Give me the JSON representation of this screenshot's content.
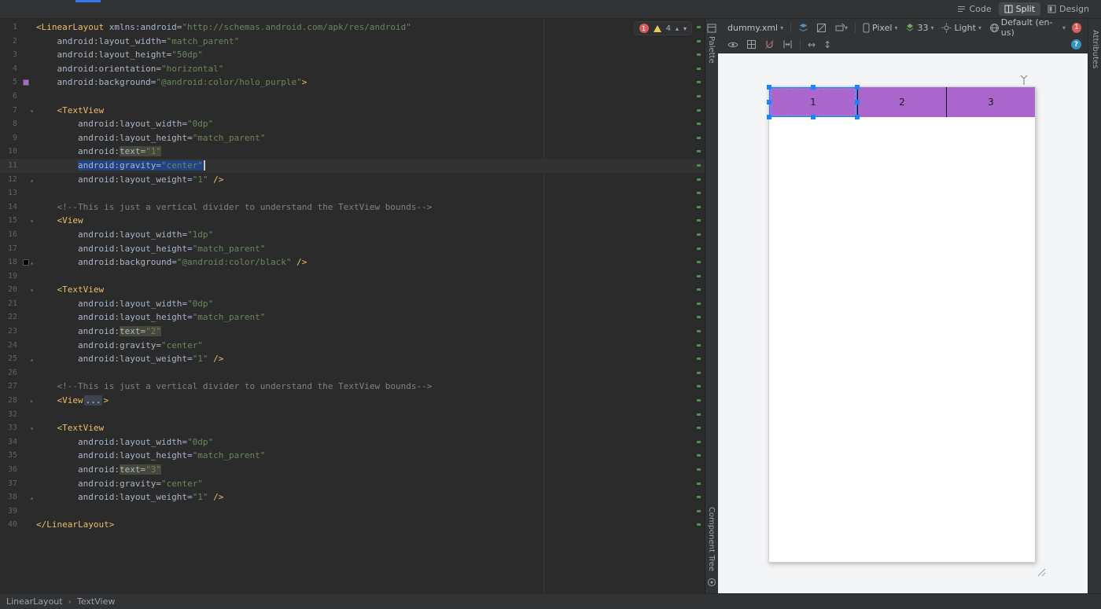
{
  "window": {
    "mode_tabs": [
      {
        "label": "Code"
      },
      {
        "label": "Split"
      },
      {
        "label": "Design"
      }
    ],
    "active_mode": "Split"
  },
  "icons": {
    "dropdown": "▾",
    "prev_issue": "▴",
    "next_issue": "▾",
    "fold_open": "▾",
    "fold_close": "▴",
    "fold_folded": "▸",
    "h_arrow": "↔",
    "v_arrow": "↕",
    "help": "?"
  },
  "editor": {
    "inspection": {
      "errors": "1",
      "warnings": "4"
    },
    "breadcrumbs": [
      "LinearLayout",
      "TextView"
    ],
    "breadcrumb_sep": "›",
    "lines": [
      {
        "n": "1",
        "tk": [
          [
            "t",
            "<LinearLayout"
          ],
          [
            "a",
            " xmlns:android"
          ],
          [
            "p",
            "="
          ],
          [
            "s",
            "\"http://schemas.android.com/apk/res/android\""
          ]
        ]
      },
      {
        "n": "2",
        "tk": [
          [
            "a",
            "    android:layout_width"
          ],
          [
            "p",
            "="
          ],
          [
            "s",
            "\"match_parent\""
          ]
        ]
      },
      {
        "n": "3",
        "tk": [
          [
            "a",
            "    android:layout_height"
          ],
          [
            "p",
            "="
          ],
          [
            "s",
            "\"50dp\""
          ]
        ]
      },
      {
        "n": "4",
        "tk": [
          [
            "a",
            "    android:orientation"
          ],
          [
            "p",
            "="
          ],
          [
            "s",
            "\"horizontal\""
          ]
        ]
      },
      {
        "n": "5",
        "sw": "#aa66cc",
        "tk": [
          [
            "a",
            "    android:background"
          ],
          [
            "p",
            "="
          ],
          [
            "s",
            "\"@android:color/holo_purple\""
          ],
          [
            "t",
            ">"
          ]
        ]
      },
      {
        "n": "6",
        "tk": []
      },
      {
        "n": "7",
        "fold": "open",
        "tk": [
          [
            "t",
            "    <TextView"
          ]
        ]
      },
      {
        "n": "8",
        "tk": [
          [
            "a",
            "        android:layout_width"
          ],
          [
            "p",
            "="
          ],
          [
            "s",
            "\"0dp\""
          ]
        ]
      },
      {
        "n": "9",
        "tk": [
          [
            "a",
            "        android:layout_height"
          ],
          [
            "p",
            "="
          ],
          [
            "s",
            "\"match_parent\""
          ]
        ]
      },
      {
        "n": "10",
        "tk": [
          [
            "a",
            "        android:"
          ],
          [
            "a occ",
            "text"
          ],
          [
            "p occ",
            "="
          ],
          [
            "s occ",
            "\"1\""
          ]
        ]
      },
      {
        "n": "11",
        "cur": true,
        "tk": [
          [
            "w",
            "        "
          ],
          [
            "a sel",
            "android:gravity"
          ],
          [
            "p sel",
            "="
          ],
          [
            "s sel",
            "\"center\""
          ],
          [
            "caret",
            ""
          ]
        ]
      },
      {
        "n": "12",
        "fold": "close",
        "tk": [
          [
            "a",
            "        android:layout_weight"
          ],
          [
            "p",
            "="
          ],
          [
            "s",
            "\"1\""
          ],
          [
            "t",
            " />"
          ]
        ]
      },
      {
        "n": "13",
        "tk": []
      },
      {
        "n": "14",
        "tk": [
          [
            "c",
            "    <!--This is just a vertical divider to understand the TextView bounds-->"
          ]
        ]
      },
      {
        "n": "15",
        "fold": "open",
        "tk": [
          [
            "t",
            "    <View"
          ]
        ]
      },
      {
        "n": "16",
        "tk": [
          [
            "a",
            "        android:layout_width"
          ],
          [
            "p",
            "="
          ],
          [
            "s",
            "\"1dp\""
          ]
        ]
      },
      {
        "n": "17",
        "tk": [
          [
            "a",
            "        android:layout_height"
          ],
          [
            "p",
            "="
          ],
          [
            "s",
            "\"match_parent\""
          ]
        ]
      },
      {
        "n": "18",
        "sw": "#000000",
        "fold": "close",
        "tk": [
          [
            "a",
            "        android:background"
          ],
          [
            "p",
            "="
          ],
          [
            "s",
            "\"@android:color/black\""
          ],
          [
            "t",
            " />"
          ]
        ]
      },
      {
        "n": "19",
        "tk": []
      },
      {
        "n": "20",
        "fold": "open",
        "tk": [
          [
            "t",
            "    <TextView"
          ]
        ]
      },
      {
        "n": "21",
        "tk": [
          [
            "a",
            "        android:layout_width"
          ],
          [
            "p",
            "="
          ],
          [
            "s",
            "\"0dp\""
          ]
        ]
      },
      {
        "n": "22",
        "tk": [
          [
            "a",
            "        android:layout_height"
          ],
          [
            "p",
            "="
          ],
          [
            "s",
            "\"match_parent\""
          ]
        ]
      },
      {
        "n": "23",
        "tk": [
          [
            "a",
            "        android:"
          ],
          [
            "a occ",
            "text"
          ],
          [
            "p occ",
            "="
          ],
          [
            "s occ",
            "\"2\""
          ]
        ]
      },
      {
        "n": "24",
        "tk": [
          [
            "a",
            "        android:gravity"
          ],
          [
            "p",
            "="
          ],
          [
            "s",
            "\"center\""
          ]
        ]
      },
      {
        "n": "25",
        "fold": "close",
        "tk": [
          [
            "a",
            "        android:layout_weight"
          ],
          [
            "p",
            "="
          ],
          [
            "s",
            "\"1\""
          ],
          [
            "t",
            " />"
          ]
        ]
      },
      {
        "n": "26",
        "tk": []
      },
      {
        "n": "27",
        "tk": [
          [
            "c",
            "    <!--This is just a vertical divider to understand the TextView bounds-->"
          ]
        ]
      },
      {
        "n": "28",
        "fold": "folded",
        "tk": [
          [
            "t",
            "    <View"
          ],
          [
            "f",
            "..."
          ],
          [
            "t",
            ">"
          ]
        ]
      },
      {
        "n": "32",
        "tk": []
      },
      {
        "n": "33",
        "fold": "open",
        "tk": [
          [
            "t",
            "    <TextView"
          ]
        ]
      },
      {
        "n": "34",
        "tk": [
          [
            "a",
            "        android:layout_width"
          ],
          [
            "p",
            "="
          ],
          [
            "s",
            "\"0dp\""
          ]
        ]
      },
      {
        "n": "35",
        "tk": [
          [
            "a",
            "        android:layout_height"
          ],
          [
            "p",
            "="
          ],
          [
            "s",
            "\"match_parent\""
          ]
        ]
      },
      {
        "n": "36",
        "tk": [
          [
            "a",
            "        android:"
          ],
          [
            "a occ",
            "text"
          ],
          [
            "p occ",
            "="
          ],
          [
            "s occ",
            "\"3\""
          ]
        ]
      },
      {
        "n": "37",
        "tk": [
          [
            "a",
            "        android:gravity"
          ],
          [
            "p",
            "="
          ],
          [
            "s",
            "\"center\""
          ]
        ]
      },
      {
        "n": "38",
        "fold": "close",
        "tk": [
          [
            "a",
            "        android:layout_weight"
          ],
          [
            "p",
            "="
          ],
          [
            "s",
            "\"1\""
          ],
          [
            "t",
            " />"
          ]
        ]
      },
      {
        "n": "39",
        "tk": []
      },
      {
        "n": "40",
        "tk": [
          [
            "t",
            "</LinearLayout>"
          ]
        ]
      }
    ]
  },
  "design": {
    "toolbar": {
      "file": "dummy.xml",
      "device": "Pixel",
      "api": "33",
      "theme": "Light",
      "locale": "Default (en-us)",
      "issues": "1"
    },
    "panels": {
      "palette": "Palette",
      "component_tree": "Component Tree",
      "attributes": "Attributes"
    },
    "preview": {
      "cells": [
        "1",
        "2",
        "3"
      ],
      "selected_index": 0,
      "bar_color": "#aa66cc",
      "selection_color": "#1886f7",
      "divider_color": "#000000"
    }
  }
}
